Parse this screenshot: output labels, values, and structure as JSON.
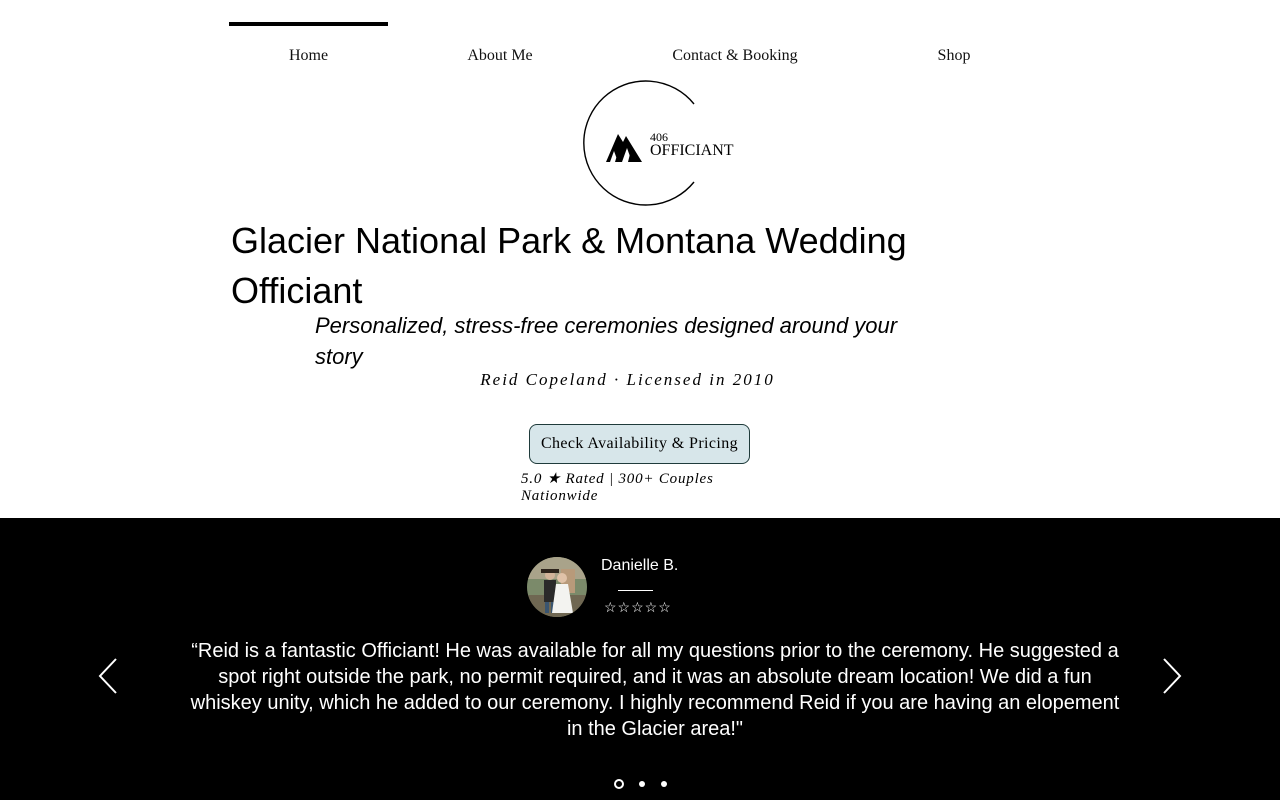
{
  "nav": {
    "items": [
      {
        "label": "Home",
        "active": true
      },
      {
        "label": "About Me"
      },
      {
        "label": "Contact & Booking"
      },
      {
        "label": "Shop"
      }
    ]
  },
  "logo": {
    "number": "406",
    "word": "OFFICIANT",
    "icon": "mountain-trees-icon"
  },
  "hero": {
    "headline": "Glacier National Park & Montana Wedding Officiant",
    "subhead": "Personalized, stress-free ceremonies designed around your story",
    "byline": "Reid Copeland · Licensed in 2010",
    "cta": "Check Availability & Pricing",
    "rating": "5.0 ★ Rated | 300+ Couples Nationwide"
  },
  "review": {
    "name": "Danielle B.",
    "stars": "☆☆☆☆☆",
    "quote": "“Reid is a fantastic Officiant! He was available for all my questions prior to the ceremony. He suggested a spot right outside the park, no permit required, and it was an absolute dream location! We did a fun whiskey unity, which he added to our ceremony. I highly recommend Reid if you are having an elopement in the Glacier area!\"",
    "prev_icon": "chevron-left-icon",
    "next_icon": "chevron-right-icon"
  },
  "colors": {
    "accent": "#d7e6ea",
    "dark": "#000000"
  }
}
